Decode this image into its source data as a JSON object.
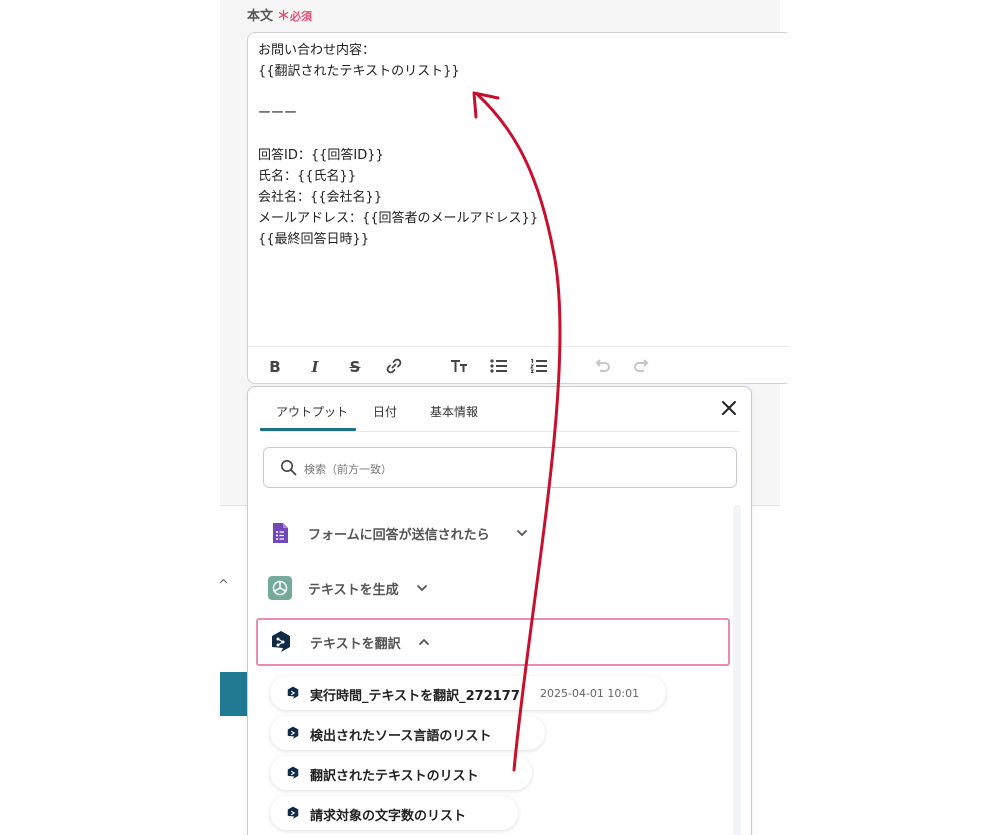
{
  "field": {
    "label": "本文",
    "required_star": "＊",
    "required_text": "必須"
  },
  "editor": {
    "content": "お問い合わせ内容：\n{{翻訳されたテキストのリスト}}\n\nーーー\n\n回答ID：{{回答ID}}\n氏名：{{氏名}}\n会社名：{{会社名}}\nメールアドレス：{{回答者のメールアドレス}}\n{{最終回答日時}}"
  },
  "toolbar": {
    "bold_glyph": "B",
    "italic_glyph": "I",
    "strike_glyph": "S"
  },
  "popover": {
    "tabs": [
      {
        "label": "アウトプット",
        "active": true
      },
      {
        "label": "日付",
        "active": false
      },
      {
        "label": "基本情報",
        "active": false
      }
    ],
    "search_placeholder": "検索（前方一致）",
    "apps": [
      {
        "label": "フォームに回答が送信されたら",
        "icon": "google-forms-icon",
        "expanded": false
      },
      {
        "label": "テキストを生成",
        "icon": "chatgpt-icon",
        "expanded": false
      },
      {
        "label": "テキストを翻訳",
        "icon": "deepl-icon",
        "expanded": true
      }
    ],
    "chips": [
      {
        "label": "実行時間_テキストを翻訳_272177",
        "meta": "2025-04-01 10:01"
      },
      {
        "label": "検出されたソース言語のリスト"
      },
      {
        "label": "翻訳されたテキストのリスト"
      },
      {
        "label": "請求対象の文字数のリスト"
      }
    ]
  },
  "colors": {
    "accent": "#1f6f86",
    "required": "#e05276",
    "selected_border": "#ea8cb2",
    "annotation_arrow": "#c8102e",
    "forms_purple": "#7248b9",
    "chatgpt_green": "#74aa9c",
    "deepl_navy": "#0f2b46"
  }
}
